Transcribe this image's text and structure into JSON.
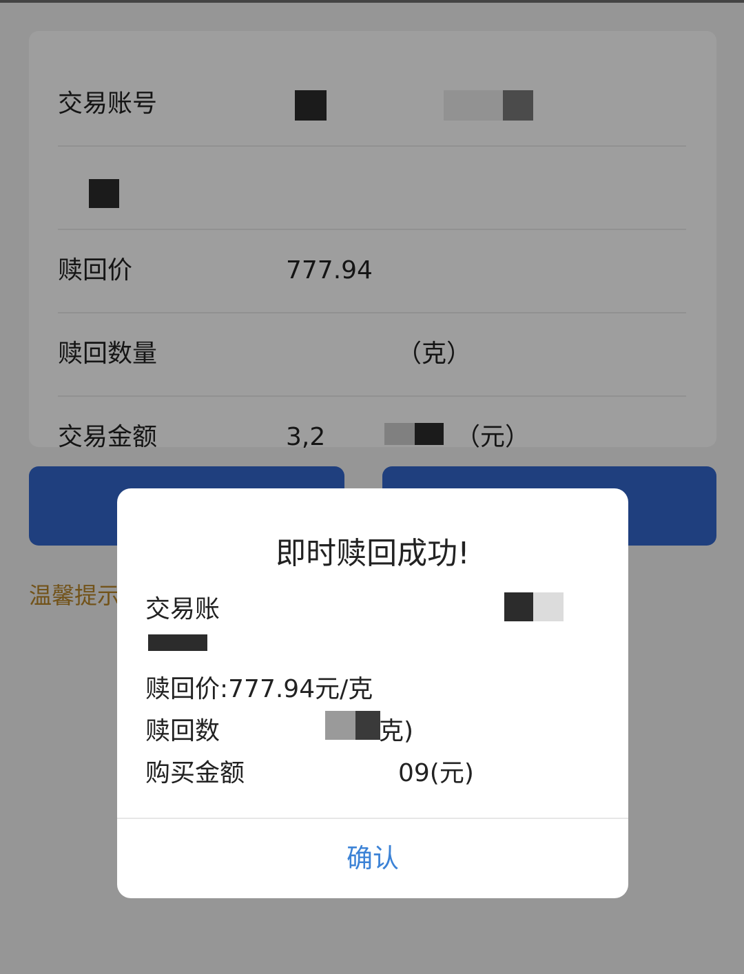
{
  "card": {
    "rows": [
      {
        "label": "交易账号",
        "value": "",
        "unit": ""
      },
      {
        "label": "",
        "value": "",
        "unit": ""
      },
      {
        "label": "赎回价",
        "value": "777.94",
        "unit": ""
      },
      {
        "label": "赎回数量",
        "value": "",
        "unit": "（克）"
      },
      {
        "label": "交易金额",
        "value": "3,2",
        "unit": "（元）"
      }
    ]
  },
  "tips": {
    "text": "温馨提示"
  },
  "dialog": {
    "title": "即时赎回成功!",
    "lines": {
      "account": "交易账",
      "name": "",
      "price": "赎回价:777.94元/克",
      "quantity_prefix": "赎回数",
      "quantity_suffix": "克)",
      "amount_prefix": "购买金额",
      "amount_suffix": "09(元)"
    },
    "confirm_label": "确认"
  },
  "colors": {
    "primary": "#3366cc",
    "link": "#3b82d6",
    "tips": "#b8862b"
  }
}
